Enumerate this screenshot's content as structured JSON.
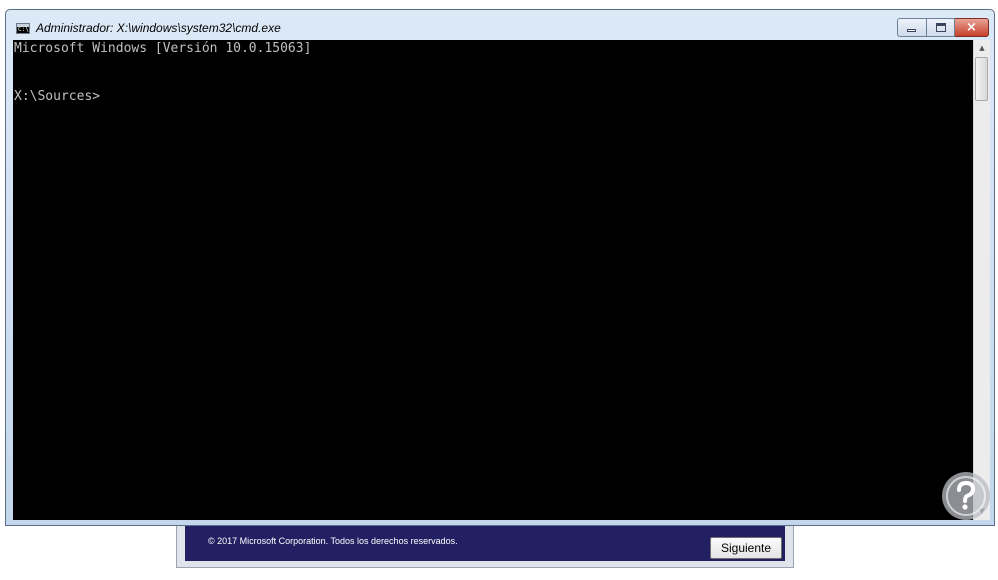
{
  "cmd_window": {
    "title": "Administrador: X:\\windows\\system32\\cmd.exe",
    "icon_glyph": "C:\\",
    "controls": {
      "minimize": "minimize-icon",
      "maximize": "maximize-icon",
      "close": "×"
    },
    "console_lines": [
      "Microsoft Windows [Versión 10.0.15063]",
      "X:\\Sources>"
    ],
    "background_color": "#000000",
    "text_color": "#c0c0c0"
  },
  "setup_window": {
    "copyright": "© 2017 Microsoft Corporation. Todos los derechos reservados.",
    "next_button": "Siguiente",
    "footer_color": "#231f63"
  },
  "scrollbar": {
    "up_arrow": "▲",
    "down_arrow": "▼"
  },
  "watermark": {
    "icon": "question-mark-logo-icon"
  }
}
